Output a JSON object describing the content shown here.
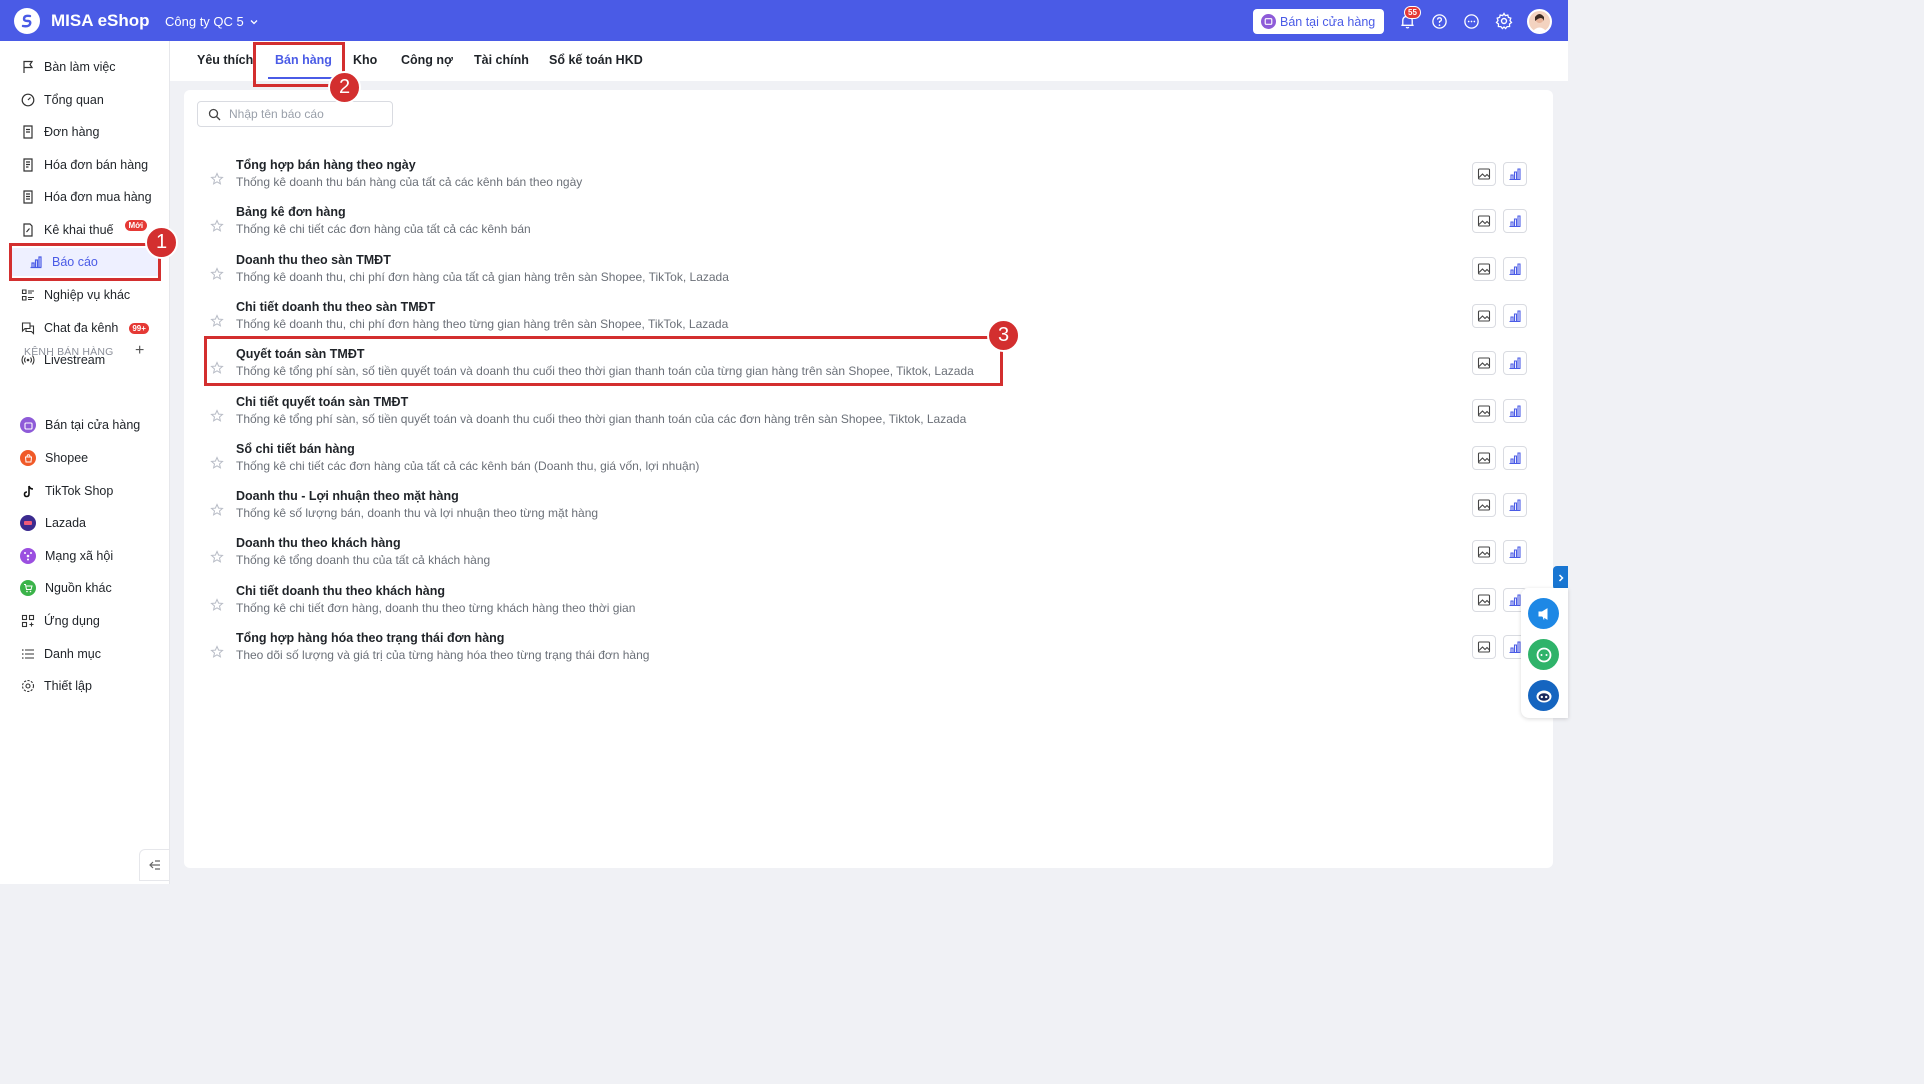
{
  "header": {
    "app_title": "MISA eShop",
    "company": "Công ty QC 5",
    "store_button": "Bán tại cửa hàng",
    "notification_count": "55",
    "brand_color": "#4a5be6"
  },
  "sidebar": {
    "items": [
      {
        "label": "Bàn làm việc",
        "icon": "flag-icon"
      },
      {
        "label": "Tổng quan",
        "icon": "gauge-icon"
      },
      {
        "label": "Đơn hàng",
        "icon": "document-icon"
      },
      {
        "label": "Hóa đơn bán hàng",
        "icon": "invoice-icon"
      },
      {
        "label": "Hóa đơn mua hàng",
        "icon": "receipt-icon"
      },
      {
        "label": "Kê khai thuế",
        "icon": "tax-icon",
        "badge": "Mới"
      },
      {
        "label": "Báo cáo",
        "icon": "bar-chart-icon",
        "active": true
      },
      {
        "label": "Nghiệp vụ khác",
        "icon": "list-icon"
      },
      {
        "label": "Chat đa kênh",
        "icon": "chat-icon",
        "badge": "99+"
      },
      {
        "label": "Livestream",
        "icon": "broadcast-icon"
      }
    ],
    "channels_label": "KÊNH BÁN HÀNG",
    "channels": [
      {
        "label": "Bán tại cửa hàng",
        "color": "#8e5bd8"
      },
      {
        "label": "Shopee",
        "color": "#f05a28"
      },
      {
        "label": "TikTok Shop",
        "color": "#111111"
      },
      {
        "label": "Lazada",
        "color": "#3b2a8f"
      },
      {
        "label": "Mạng xã hội",
        "color": "#9b4fe0"
      },
      {
        "label": "Nguồn khác",
        "color": "#3bb34a"
      }
    ],
    "bottom_items": [
      {
        "label": "Ứng dụng",
        "icon": "apps-icon"
      },
      {
        "label": "Danh mục",
        "icon": "menu-list-icon"
      },
      {
        "label": "Thiết lập",
        "icon": "gear-icon"
      }
    ]
  },
  "tabs": [
    {
      "label": "Yêu thích"
    },
    {
      "label": "Bán hàng",
      "active": true
    },
    {
      "label": "Kho"
    },
    {
      "label": "Công nợ"
    },
    {
      "label": "Tài chính"
    },
    {
      "label": "Sổ kế toán HKD"
    }
  ],
  "search": {
    "placeholder": "Nhập tên báo cáo"
  },
  "reports": [
    {
      "title": "Tổng hợp bán hàng theo ngày",
      "desc": "Thống kê doanh thu bán hàng của tất cả các kênh bán theo ngày"
    },
    {
      "title": "Bảng kê đơn hàng",
      "desc": "Thống kê chi tiết các đơn hàng của tất cả các kênh bán"
    },
    {
      "title": "Doanh thu theo sàn TMĐT",
      "desc": "Thống kê doanh thu, chi phí đơn hàng của tất cả gian hàng trên sàn Shopee, TikTok, Lazada"
    },
    {
      "title": "Chi tiết doanh thu theo sàn TMĐT",
      "desc": "Thống kê doanh thu, chi phí đơn hàng theo từng gian hàng trên sàn Shopee, TikTok, Lazada"
    },
    {
      "title": "Quyết toán sàn TMĐT",
      "desc": "Thống kê tổng phí sàn, số tiền quyết toán và doanh thu cuối theo thời gian thanh toán của từng gian hàng trên sàn Shopee, Tiktok, Lazada"
    },
    {
      "title": "Chi tiết quyết toán sàn TMĐT",
      "desc": "Thống kê tổng phí sàn, số tiền quyết toán và doanh thu cuối theo thời gian thanh toán của các đơn hàng trên sàn Shopee, Tiktok, Lazada"
    },
    {
      "title": "Sổ chi tiết bán hàng",
      "desc": "Thống kê chi tiết các đơn hàng của tất cả các kênh bán (Doanh thu, giá vốn, lợi nhuận)"
    },
    {
      "title": "Doanh thu - Lợi nhuận theo mặt hàng",
      "desc": "Thống kê số lượng bán, doanh thu và lợi nhuận theo từng mặt hàng"
    },
    {
      "title": "Doanh thu theo khách hàng",
      "desc": "Thống kê tổng doanh thu của tất cả khách hàng"
    },
    {
      "title": "Chi tiết doanh thu theo khách hàng",
      "desc": "Thống kê chi tiết đơn hàng, doanh thu theo từng khách hàng theo thời gian"
    },
    {
      "title": "Tổng hợp hàng hóa theo trạng thái đơn hàng",
      "desc": "Theo dõi số lượng và giá trị của từng hàng hóa theo từng trạng thái đơn hàng"
    }
  ],
  "annotations": [
    "1",
    "2",
    "3"
  ]
}
